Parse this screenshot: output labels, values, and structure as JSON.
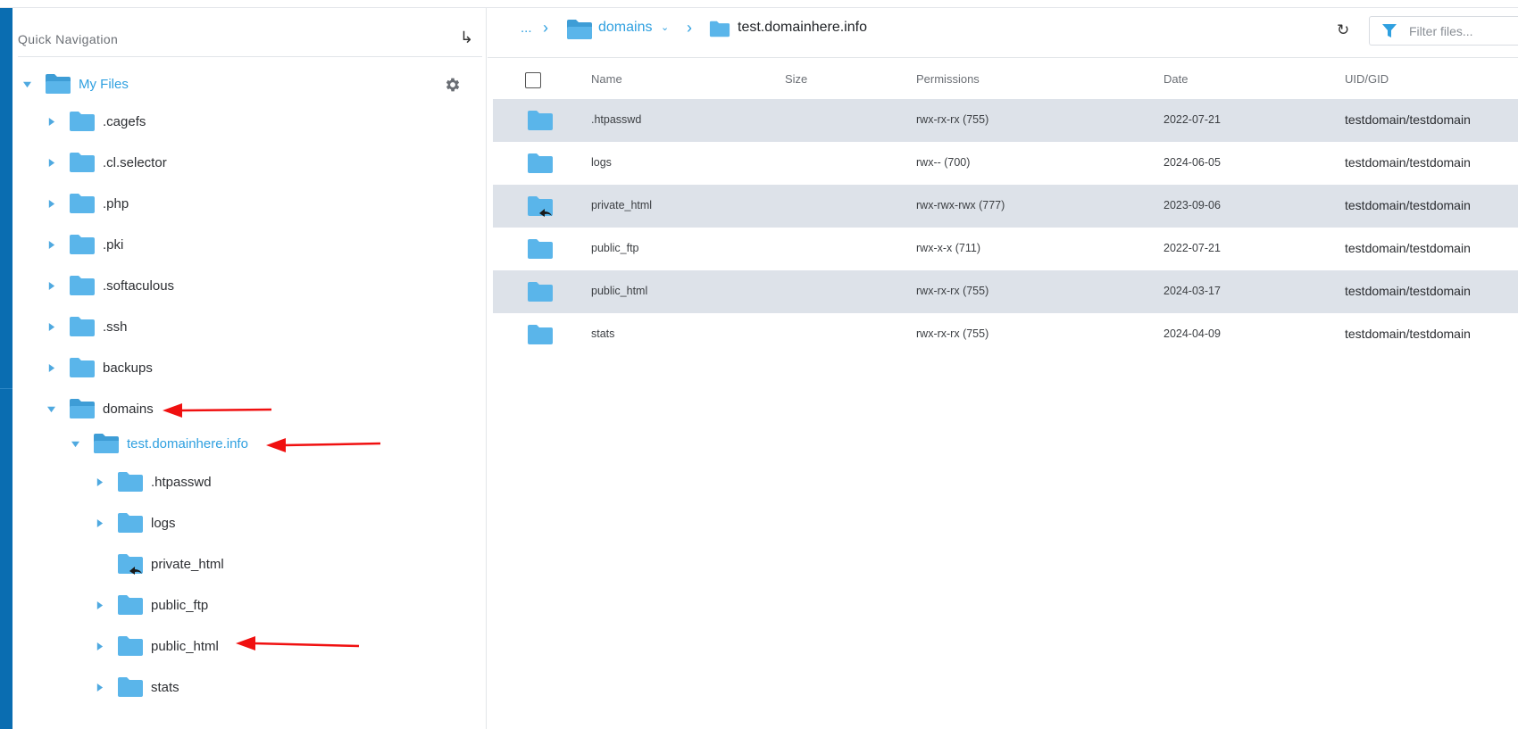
{
  "sidebar": {
    "title": "Quick Navigation",
    "jump_icon": "return-arrow-icon",
    "root_label": "My Files",
    "settings_icon": "gear-icon",
    "tree": [
      {
        "label": ".cagefs",
        "caret": "collapsed"
      },
      {
        "label": ".cl.selector",
        "caret": "collapsed"
      },
      {
        "label": ".php",
        "caret": "collapsed"
      },
      {
        "label": ".pki",
        "caret": "collapsed"
      },
      {
        "label": ".softaculous",
        "caret": "collapsed"
      },
      {
        "label": ".ssh",
        "caret": "collapsed"
      },
      {
        "label": "backups",
        "caret": "collapsed"
      },
      {
        "label": "domains",
        "caret": "expanded"
      },
      {
        "label": "test.domainhere.info",
        "caret": "expanded"
      },
      {
        "label": ".htpasswd",
        "caret": "collapsed"
      },
      {
        "label": "logs",
        "caret": "collapsed"
      },
      {
        "label": "private_html",
        "caret": "none",
        "symlink": true
      },
      {
        "label": "public_ftp",
        "caret": "collapsed"
      },
      {
        "label": "public_html",
        "caret": "collapsed"
      },
      {
        "label": "stats",
        "caret": "collapsed"
      }
    ]
  },
  "breadcrumb": {
    "ellipsis": "...",
    "parent": "domains",
    "current": "test.domainhere.info"
  },
  "toolbar": {
    "refresh_icon": "refresh-icon",
    "filter_icon": "filter-icon",
    "filter_placeholder": "Filter files..."
  },
  "table": {
    "columns": [
      "Name",
      "Size",
      "Permissions",
      "Date",
      "UID/GID"
    ],
    "rows": [
      {
        "name": ".htpasswd",
        "size": "",
        "permissions": "rwx-rx-rx (755)",
        "date": "2022-07-21",
        "uid": "testdomain/testdomain",
        "symlink": false
      },
      {
        "name": "logs",
        "size": "",
        "permissions": "rwx-- (700)",
        "date": "2024-06-05",
        "uid": "testdomain/testdomain",
        "symlink": false
      },
      {
        "name": "private_html",
        "size": "",
        "permissions": "rwx-rwx-rwx (777)",
        "date": "2023-09-06",
        "uid": "testdomain/testdomain",
        "symlink": true
      },
      {
        "name": "public_ftp",
        "size": "",
        "permissions": "rwx-x-x (711)",
        "date": "2022-07-21",
        "uid": "testdomain/testdomain",
        "symlink": false
      },
      {
        "name": "public_html",
        "size": "",
        "permissions": "rwx-rx-rx (755)",
        "date": "2024-03-17",
        "uid": "testdomain/testdomain",
        "symlink": false
      },
      {
        "name": "stats",
        "size": "",
        "permissions": "rwx-rx-rx (755)",
        "date": "2024-04-09",
        "uid": "testdomain/testdomain",
        "symlink": false
      }
    ]
  },
  "colors": {
    "accent": "#2fa0e0",
    "folder": "#5ab5ea",
    "folder_dark": "#3e9dd6",
    "row_shade": "#dde2e9",
    "left_bar": "#0a6db1",
    "annotation_arrow": "#f01010"
  }
}
